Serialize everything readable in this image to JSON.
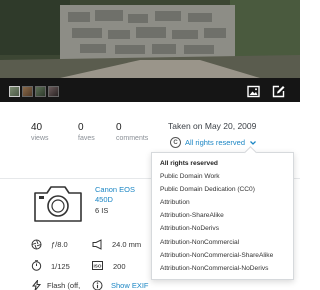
{
  "stats": {
    "views": {
      "value": "40",
      "label": "views"
    },
    "faves": {
      "value": "0",
      "label": "faves"
    },
    "comments": {
      "value": "0",
      "label": "comments"
    }
  },
  "taken": "Taken on May 20, 2009",
  "license": {
    "icon_text": "C",
    "current": "All rights reserved",
    "options": [
      "All rights reserved",
      "Public Domain Work",
      "Public Domain Dedication (CC0)",
      "Attribution",
      "Attribution-ShareAlike",
      "Attribution-NoDerivs",
      "Attribution-NonCommercial",
      "Attribution-NonCommercial-ShareAlike",
      "Attribution-NonCommercial-NoDerivs"
    ],
    "selected_index": 0
  },
  "camera": {
    "name": "Canon EOS 450D",
    "lens": "6 IS"
  },
  "exif": {
    "aperture": "ƒ/8.0",
    "focal_length": "24.0 mm",
    "shutter": "1/125",
    "iso": "200",
    "flash": "Flash (off,",
    "show_exif": "Show EXIF"
  },
  "icons": {
    "viewer": [
      "image-icon",
      "edit-icon"
    ],
    "exif": [
      "aperture-icon",
      "focal-length-icon",
      "shutter-icon",
      "iso-icon",
      "flash-icon",
      "info-icon"
    ]
  },
  "colors": {
    "link": "#1b86c4",
    "viewer_bg": "#151515"
  }
}
